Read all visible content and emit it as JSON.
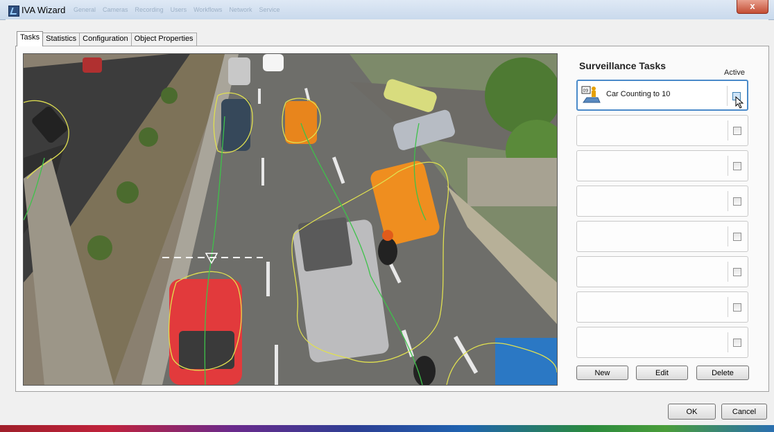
{
  "window": {
    "title": "IVA Wizard",
    "menu_items": [
      "General",
      "Cameras",
      "Recording",
      "Users",
      "Workflows",
      "Network",
      "Service"
    ],
    "close_symbol": "x"
  },
  "tabs": [
    {
      "label": "Tasks",
      "active": true
    },
    {
      "label": "Statistics",
      "active": false
    },
    {
      "label": "Configuration",
      "active": false
    },
    {
      "label": "Object Properties",
      "active": false
    }
  ],
  "surveillance": {
    "title": "Surveillance Tasks",
    "active_header": "Active",
    "tasks": [
      {
        "label": "Car Counting to 10",
        "active": false,
        "icon": "car-counting-icon",
        "selected": true
      },
      {
        "label": "",
        "active": false
      },
      {
        "label": "",
        "active": false
      },
      {
        "label": "",
        "active": false
      },
      {
        "label": "",
        "active": false
      },
      {
        "label": "",
        "active": false
      },
      {
        "label": "",
        "active": false
      },
      {
        "label": "",
        "active": false
      }
    ],
    "buttons": {
      "new": "New",
      "edit": "Edit",
      "delete": "Delete"
    }
  },
  "dialog": {
    "ok": "OK",
    "cancel": "Cancel"
  },
  "colors": {
    "selection": "#4a8ac9",
    "tracking_outline": "#e0e050",
    "trajectory": "#3ec24a",
    "counting_line": "#ffffff"
  }
}
